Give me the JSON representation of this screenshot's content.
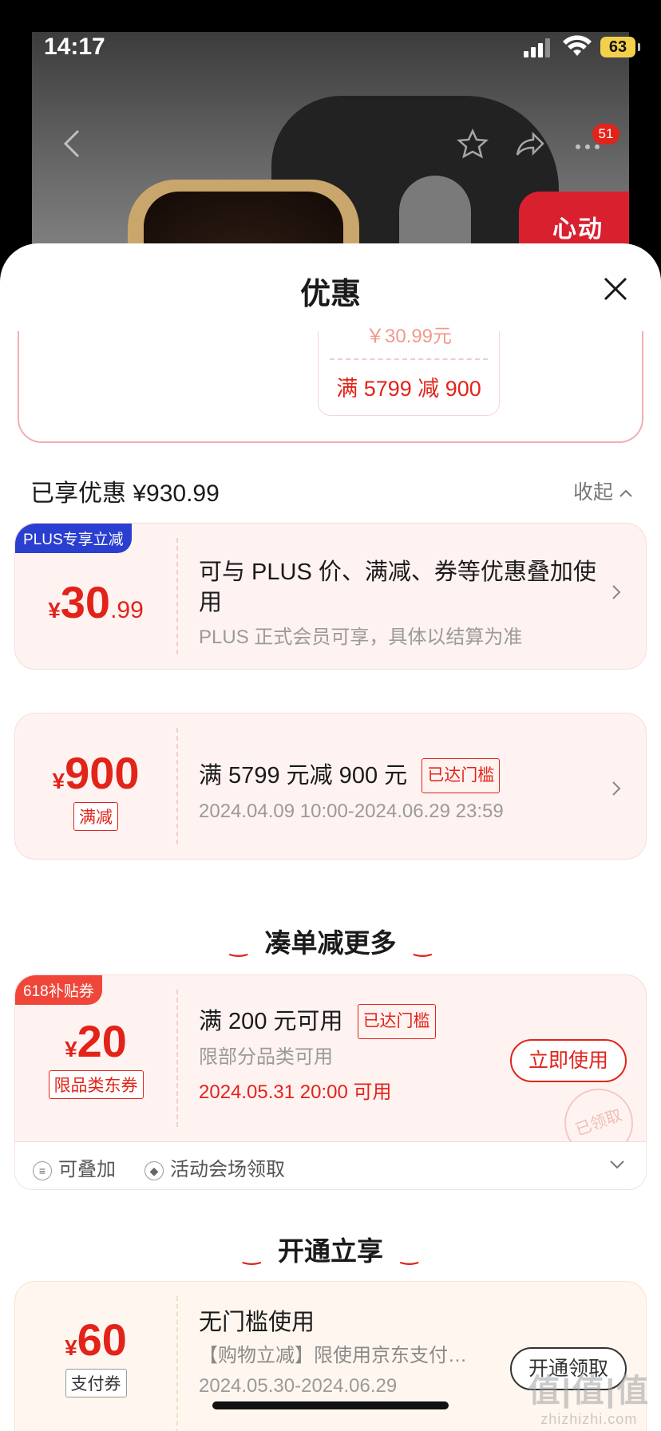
{
  "status_bar": {
    "time": "14:17",
    "battery": "63"
  },
  "cart_badge": "51",
  "product_promo": "心动",
  "sheet": {
    "title": "优惠",
    "top_card": {
      "faded_text": "￥30.99元",
      "rule": "满 5799 减 900"
    },
    "summary": "已享优惠 ¥930.99",
    "collapse_label": "收起"
  },
  "plus_card": {
    "corner_tag": "PLUS专享立减",
    "yen": "¥",
    "amount_int": "30",
    "amount_dec": ".99",
    "title": "可与 PLUS 价、满减、券等优惠叠加使用",
    "subtitle": "PLUS 正式会员可享，具体以结算为准"
  },
  "discount_card": {
    "yen": "¥",
    "amount": "900",
    "type_tag": "满减",
    "title": "满 5799 元减 900 元",
    "threshold_tag": "已达门槛",
    "date_range": "2024.04.09 10:00-2024.06.29 23:59"
  },
  "section_more": {
    "title": "凑单减更多"
  },
  "coupon_card": {
    "corner_tag": "618补贴券",
    "yen": "¥",
    "amount": "20",
    "type_tag": "限品类东券",
    "title": "满 200 元可用",
    "threshold_tag": "已达门槛",
    "subtitle": "限部分品类可用",
    "date": "2024.05.31 20:00 可用",
    "button": "立即使用",
    "stamp": "已领取",
    "footer_stackable": "可叠加",
    "footer_source": "活动会场领取"
  },
  "section_open": {
    "title": "开通立享"
  },
  "pay_card": {
    "yen": "¥",
    "amount": "60",
    "type_tag": "支付券",
    "title": "无门槛使用",
    "subtitle": "【购物立减】限使用京东支付…",
    "date_range": "2024.05.30-2024.06.29",
    "button": "开通领取"
  },
  "watermark": {
    "big": "值|值|值",
    "small": "zhizhizhi.com"
  },
  "colors": {
    "accent": "#e2231a",
    "plus_blue": "#2a3fd0",
    "card_bg": "#fff3f1"
  }
}
